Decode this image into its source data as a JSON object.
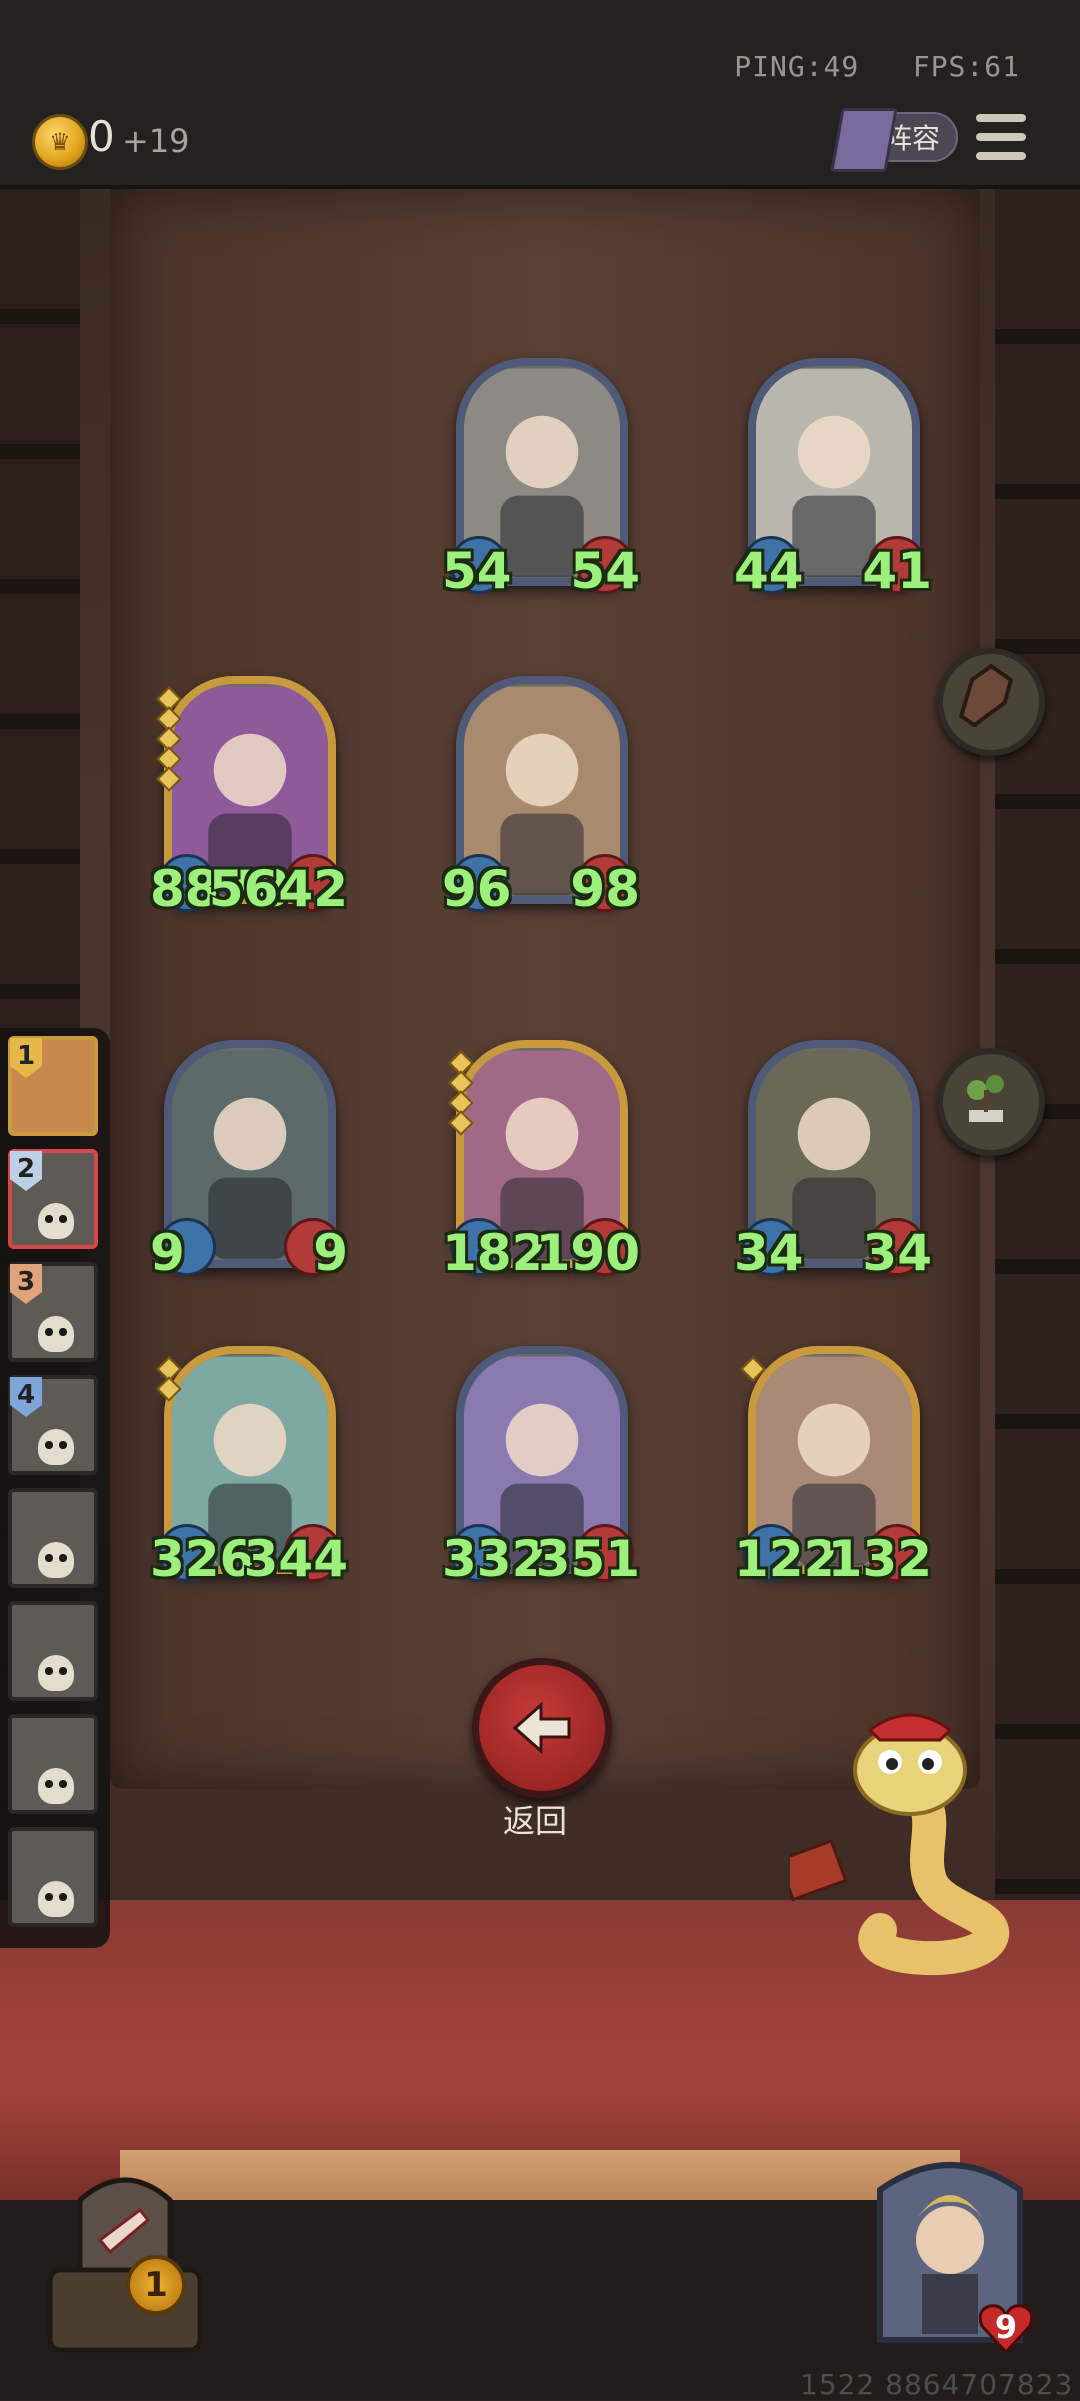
{
  "topbar": {
    "ping": "PING:49",
    "fps": "FPS:61",
    "gold": "0",
    "income": "+19",
    "lineup_label": "阵容"
  },
  "units": [
    {
      "atk": "54",
      "hp": "54",
      "gold_frame": false,
      "stars": 0,
      "portrait": "bearded-warrior"
    },
    {
      "atk": "44",
      "hp": "41",
      "gold_frame": false,
      "stars": 0,
      "portrait": "grey-cat-beast"
    },
    {
      "atk": "8878",
      "hp": "5642",
      "gold_frame": true,
      "stars": 5,
      "portrait": "pumpkin-ghosts"
    },
    {
      "atk": "96",
      "hp": "98",
      "gold_frame": false,
      "stars": 0,
      "portrait": "mohawk-rogue"
    },
    {
      "atk": "9",
      "hp": "9",
      "gold_frame": false,
      "stars": 0,
      "portrait": "horned-elf"
    },
    {
      "atk": "182",
      "hp": "190",
      "gold_frame": true,
      "stars": 4,
      "portrait": "wooden-totem"
    },
    {
      "atk": "34",
      "hp": "34",
      "gold_frame": false,
      "stars": 0,
      "portrait": "pumpkin-plant"
    },
    {
      "atk": "326",
      "hp": "344",
      "gold_frame": true,
      "stars": 2,
      "portrait": "sea-maiden"
    },
    {
      "atk": "332",
      "hp": "351",
      "gold_frame": false,
      "stars": 0,
      "portrait": "pale-bride"
    },
    {
      "atk": "122",
      "hp": "132",
      "gold_frame": true,
      "stars": 1,
      "portrait": "pink-plant-girl"
    }
  ],
  "opponents": [
    {
      "rank": "1",
      "rank_color": "#e6b84a"
    },
    {
      "rank": "2",
      "rank_color": "#bcd0e6"
    },
    {
      "rank": "3",
      "rank_color": "#e0a37a"
    },
    {
      "rank": "4",
      "rank_color": "#7ea6d8"
    },
    {
      "rank": "",
      "rank_color": ""
    },
    {
      "rank": "",
      "rank_color": ""
    },
    {
      "rank": "",
      "rank_color": ""
    },
    {
      "rank": "",
      "rank_color": ""
    }
  ],
  "back": {
    "label": "返回"
  },
  "shop": {
    "level": "1"
  },
  "hero": {
    "health": "9"
  },
  "footer": {
    "id": "1522 8864707823"
  },
  "icons": {
    "coin": "crown-coin-icon",
    "lineup": "book-icon",
    "menu": "hamburger-menu-icon",
    "sell": "coffin-icon",
    "bonsai": "bonsai-icon",
    "back": "arrow-left-icon"
  }
}
